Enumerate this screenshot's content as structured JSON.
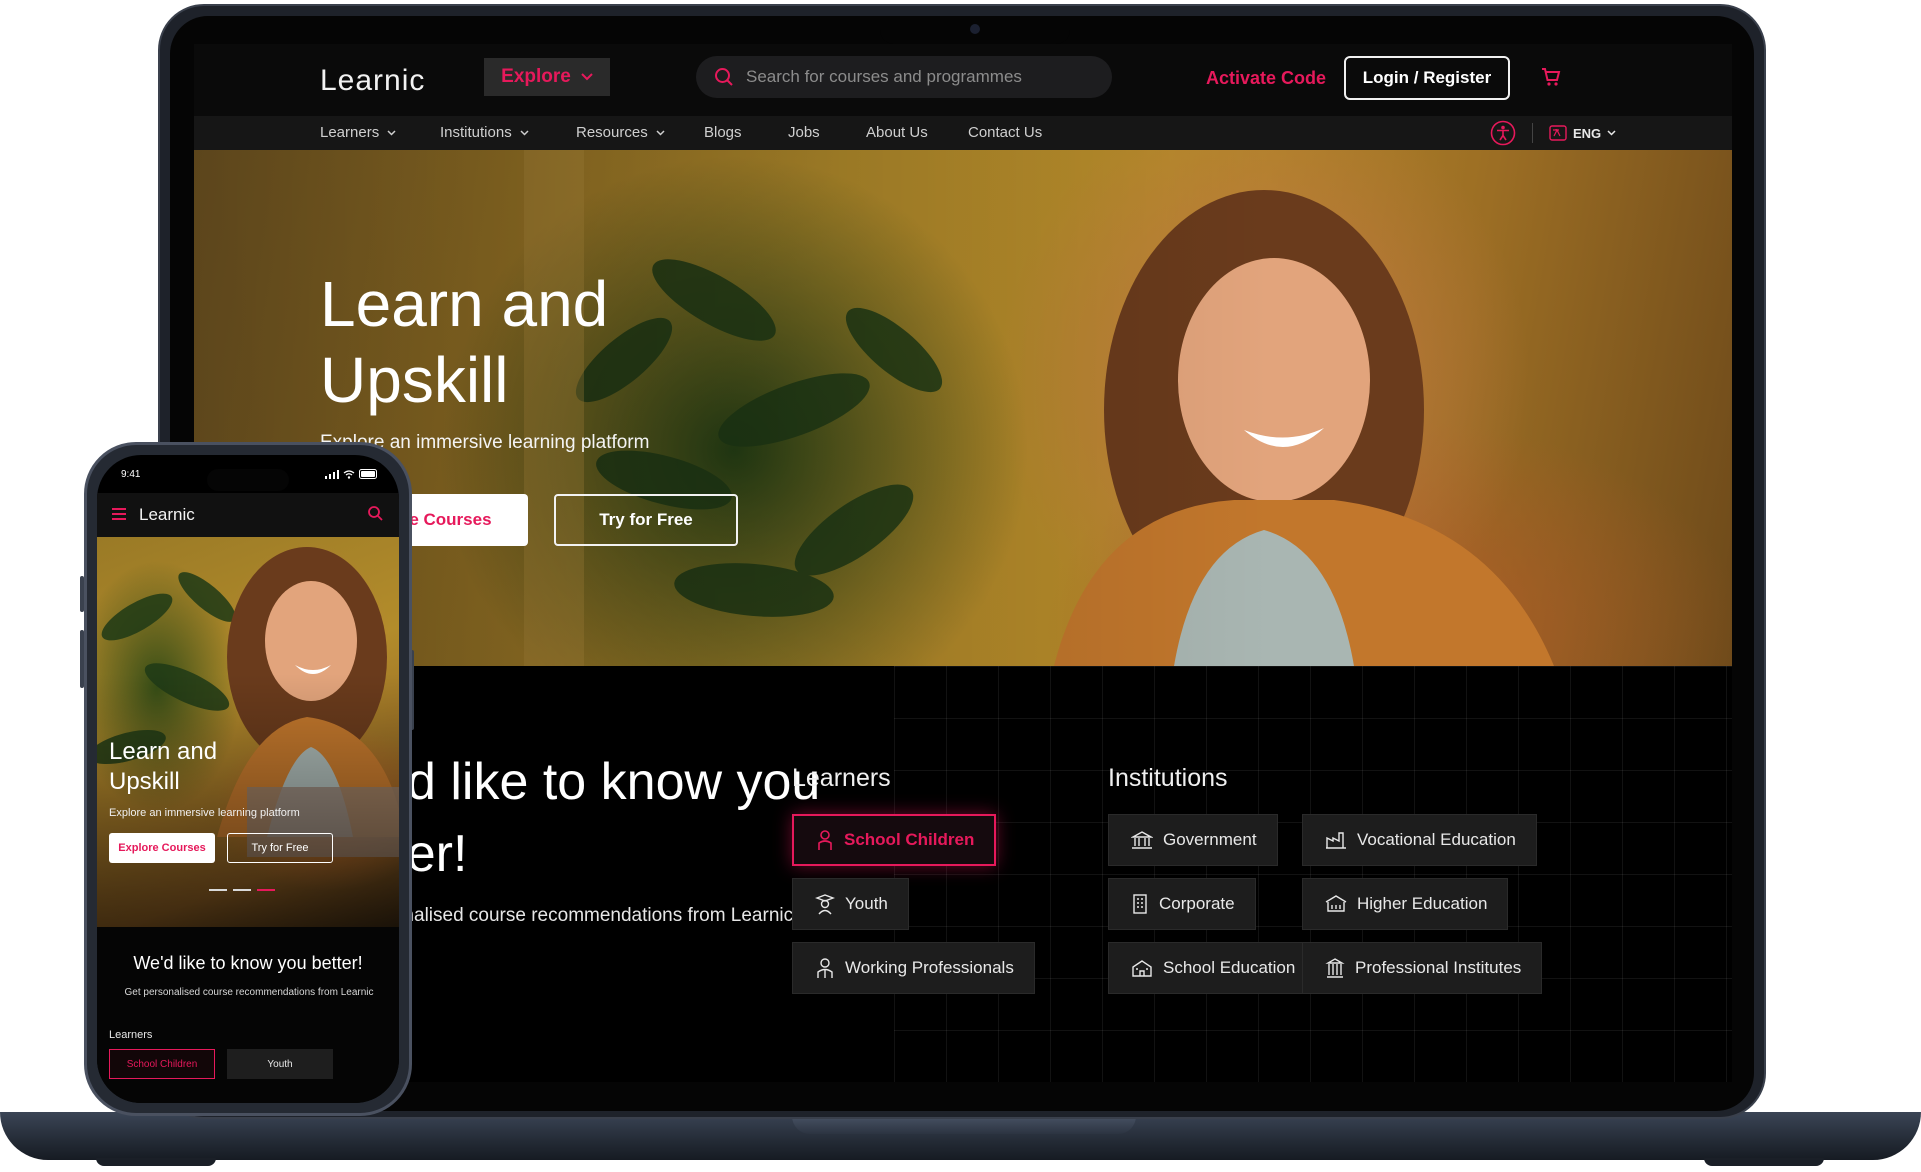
{
  "site": {
    "brand": "Learnic",
    "explore_label": "Explore",
    "search_placeholder": "Search for courses and programmes",
    "activate_code": "Activate Code",
    "login_register": "Login / Register",
    "accent_color": "#e6195b"
  },
  "nav": {
    "items": [
      {
        "label": "Learners",
        "dropdown": true
      },
      {
        "label": "Institutions",
        "dropdown": true
      },
      {
        "label": "Resources",
        "dropdown": true
      },
      {
        "label": "Blogs",
        "dropdown": false
      },
      {
        "label": "Jobs",
        "dropdown": false
      },
      {
        "label": "About Us",
        "dropdown": false
      },
      {
        "label": "Contact Us",
        "dropdown": false
      }
    ],
    "language": "ENG"
  },
  "hero": {
    "title_line1": "Learn and",
    "title_line2": "Upskill",
    "subtitle": "Explore an immersive learning platform",
    "primary_cta": "Explore Courses",
    "secondary_cta": "Try for Free"
  },
  "know": {
    "title": "We'd like to know you better!",
    "subtitle": "Get personalised course recommendations from Learnic",
    "learners_heading": "Learners",
    "institutions_heading": "Institutions",
    "learners": [
      {
        "label": "School Children",
        "icon": "student-icon",
        "active": true
      },
      {
        "label": "Youth",
        "icon": "graduate-icon",
        "active": false
      },
      {
        "label": "Working Professionals",
        "icon": "professional-icon",
        "active": false
      }
    ],
    "institutions": [
      {
        "label": "Government",
        "icon": "government-building-icon"
      },
      {
        "label": "Vocational Education",
        "icon": "factory-icon"
      },
      {
        "label": "Corporate",
        "icon": "office-building-icon"
      },
      {
        "label": "Higher Education",
        "icon": "university-icon"
      },
      {
        "label": "School Education",
        "icon": "school-icon"
      },
      {
        "label": "Professional Institutes",
        "icon": "institute-icon"
      }
    ]
  },
  "phone": {
    "time": "9:41",
    "brand": "Learnic",
    "title_line1": "Learn and",
    "title_line2": "Upskill",
    "subtitle": "Explore an immersive learning platform",
    "primary_cta": "Explore Courses",
    "secondary_cta": "Try for Free",
    "know_title": "We'd like to know you better!",
    "know_subtitle": "Get personalised course recommendations from Learnic",
    "learners_heading": "Learners",
    "chip_active": "School Children",
    "chip_other": "Youth"
  }
}
